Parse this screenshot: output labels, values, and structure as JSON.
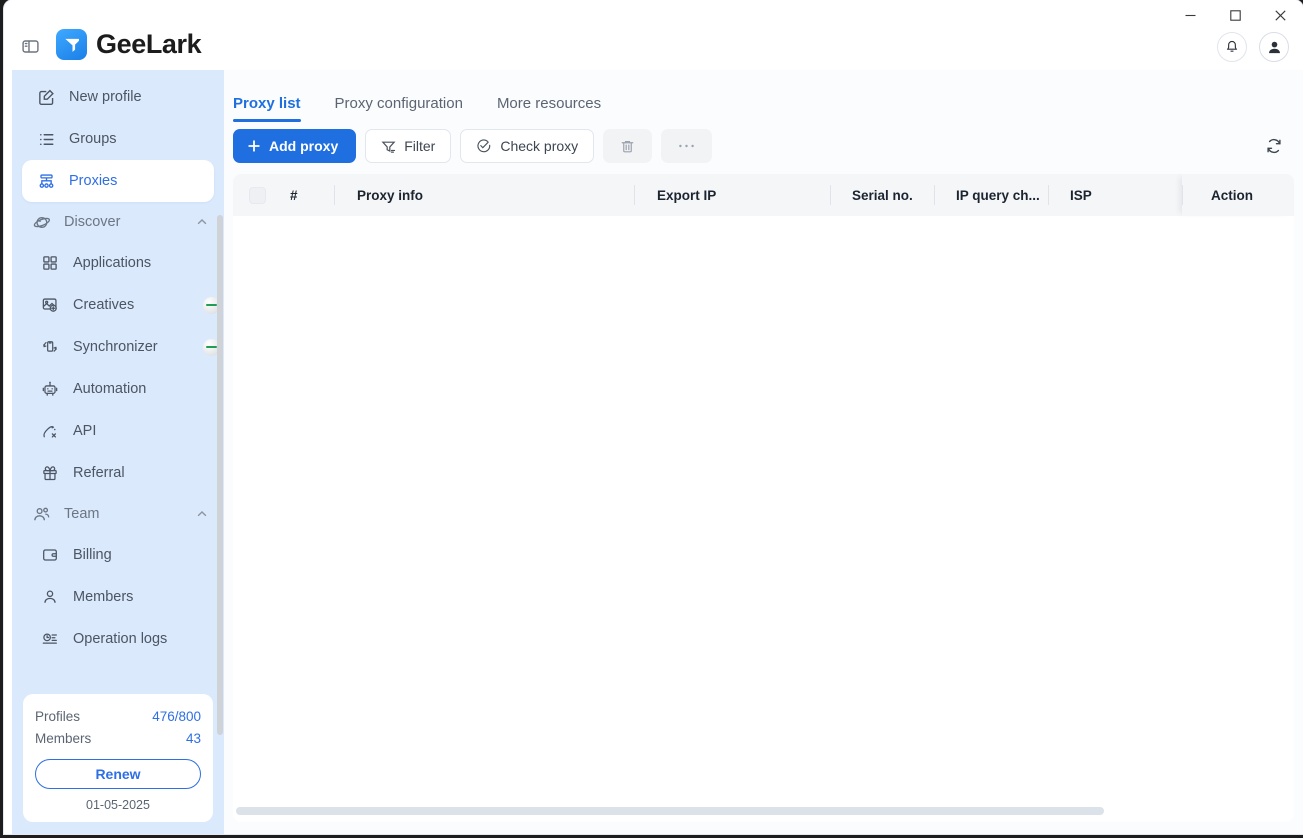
{
  "window": {
    "controls": [
      {
        "name": "minimize",
        "glyph": "minimize-icon"
      },
      {
        "name": "maximize",
        "glyph": "maximize-icon"
      },
      {
        "name": "close",
        "glyph": "close-icon"
      }
    ]
  },
  "header": {
    "sidebar_toggle_icon": "panel-toggle-icon",
    "brand_name": "GeeLark",
    "logo_icon": "geelark-logo-icon",
    "notification_icon": "bell-icon",
    "avatar_icon": "user-avatar-icon"
  },
  "sidebar": {
    "items": [
      {
        "label": "New profile",
        "icon": "edit-square-icon",
        "type": "item",
        "active": false
      },
      {
        "label": "Groups",
        "icon": "list-icon",
        "type": "item",
        "active": false
      },
      {
        "label": "Proxies",
        "icon": "proxies-network-icon",
        "type": "item",
        "active": true
      },
      {
        "label": "Discover",
        "icon": "discover-planet-icon",
        "type": "group",
        "expanded": true
      },
      {
        "label": "Applications",
        "icon": "grid-apps-icon",
        "type": "sub",
        "active": false
      },
      {
        "label": "Creatives",
        "icon": "image-plus-icon",
        "type": "sub",
        "active": false,
        "badge": "green-badge"
      },
      {
        "label": "Synchronizer",
        "icon": "sync-devices-icon",
        "type": "sub",
        "active": false,
        "badge": "green-badge"
      },
      {
        "label": "Automation",
        "icon": "robot-icon",
        "type": "sub",
        "active": false
      },
      {
        "label": "API",
        "icon": "api-icon",
        "type": "sub",
        "active": false
      },
      {
        "label": "Referral",
        "icon": "gift-icon",
        "type": "sub",
        "active": false
      },
      {
        "label": "Team",
        "icon": "team-people-icon",
        "type": "group",
        "expanded": true
      },
      {
        "label": "Billing",
        "icon": "wallet-icon",
        "type": "sub",
        "active": false
      },
      {
        "label": "Members",
        "icon": "person-icon",
        "type": "sub",
        "active": false
      },
      {
        "label": "Operation logs",
        "icon": "logs-clock-icon",
        "type": "sub",
        "active": false
      }
    ],
    "plan_card": {
      "profiles_label": "Profiles",
      "profiles_value": "476/800",
      "members_label": "Members",
      "members_value": "43",
      "renew_label": "Renew",
      "expiry_date": "01-05-2025"
    }
  },
  "main": {
    "tabs": [
      {
        "label": "Proxy list",
        "active": true
      },
      {
        "label": "Proxy configuration",
        "active": false
      },
      {
        "label": "More resources",
        "active": false
      }
    ],
    "toolbar": {
      "add_proxy_label": "Add proxy",
      "add_proxy_icon": "plus-icon",
      "filter_label": "Filter",
      "filter_icon": "filter-icon",
      "check_proxy_label": "Check proxy",
      "check_proxy_icon": "check-circle-icon",
      "delete_icon": "trash-icon",
      "more_icon": "ellipsis-icon",
      "refresh_icon": "refresh-icon"
    },
    "table": {
      "select_all_checkbox": "select-all-checkbox",
      "columns": [
        {
          "key": "num",
          "label": "#"
        },
        {
          "key": "proxy_info",
          "label": "Proxy info"
        },
        {
          "key": "export_ip",
          "label": "Export IP"
        },
        {
          "key": "serial_no",
          "label": "Serial no."
        },
        {
          "key": "ip_query_ch",
          "label": "IP query ch..."
        },
        {
          "key": "isp",
          "label": "ISP"
        },
        {
          "key": "action",
          "label": "Action"
        }
      ],
      "rows": []
    }
  },
  "colors": {
    "accent": "#1f6fe0",
    "sidebar_bg": "#dbe9fc",
    "content_bg": "#fbfcfe",
    "table_head_bg": "#f4f6f8"
  }
}
